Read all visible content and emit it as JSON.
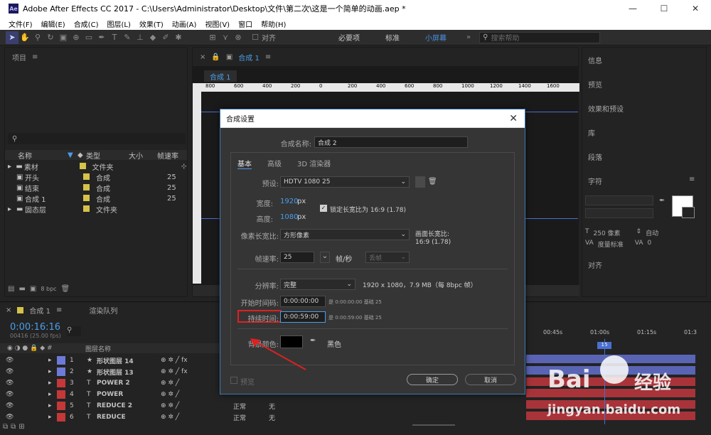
{
  "app": {
    "title": "Adobe After Effects CC 2017 - C:\\Users\\Administrator\\Desktop\\文件\\第二次\\这是一个简单的动画.aep *",
    "icon_label": "Ae"
  },
  "menu": [
    "文件(F)",
    "编辑(E)",
    "合成(C)",
    "图层(L)",
    "效果(T)",
    "动画(A)",
    "视图(V)",
    "窗口",
    "帮助(H)"
  ],
  "toolbar": {
    "align_label": "对齐",
    "workspaces": [
      "必要项",
      "标准",
      "小屏幕"
    ],
    "active_workspace": "小屏幕",
    "search_placeholder": "搜索帮助"
  },
  "project": {
    "title": "项目",
    "columns": [
      "名称",
      "类型",
      "大小",
      "帧速率"
    ],
    "items": [
      {
        "name": "素材",
        "type": "文件夹",
        "rate": "",
        "color": "#d4c24a"
      },
      {
        "name": "开头",
        "type": "合成",
        "rate": "25",
        "color": "#d4c24a"
      },
      {
        "name": "结束",
        "type": "合成",
        "rate": "25",
        "color": "#d4c24a"
      },
      {
        "name": "合成 1",
        "type": "合成",
        "rate": "25",
        "color": "#d4c24a"
      },
      {
        "name": "固态层",
        "type": "文件夹",
        "rate": "",
        "color": "#d4c24a"
      }
    ],
    "bpc": "8 bpc"
  },
  "comp_panel": {
    "tab": "合成 1",
    "label": "合成 1",
    "ruler": [
      "800",
      "600",
      "400",
      "200",
      "0",
      "200",
      "400",
      "600",
      "800",
      "1000",
      "1200",
      "1400",
      "1600"
    ]
  },
  "right_panel": {
    "items": [
      "信息",
      "预览",
      "效果和预设",
      "库",
      "段落",
      "字符",
      "对齐"
    ],
    "font_size": "250 像素",
    "auto": "自动",
    "metrics": "度量标准",
    "zero": "0"
  },
  "dialog": {
    "title": "合成设置",
    "name_label": "合成名称:",
    "name_value": "合成 2",
    "tabs": [
      "基本",
      "高级",
      "3D 渲染器"
    ],
    "preset_label": "预设:",
    "preset_value": "HDTV 1080 25",
    "width_label": "宽度:",
    "width_value": "1920",
    "height_label": "高度:",
    "height_value": "1080",
    "px": "px",
    "lock_label": "锁定长宽比为 16:9 (1.78)",
    "par_label": "像素长宽比:",
    "par_value": "方形像素",
    "frame_ar_label": "画面长宽比:",
    "frame_ar_value": "16:9 (1.78)",
    "fps_label": "帧速率:",
    "fps_value": "25",
    "fps_unit": "帧/秒",
    "fps_drop": "丢帧",
    "res_label": "分辨率:",
    "res_value": "完整",
    "res_info": "1920 x 1080，7.9 MB（每 8bpc 帧）",
    "start_label": "开始时间码:",
    "start_value": "0:00:00:00",
    "start_info": "是 0:00:00:00  基础 25",
    "dur_label": "持续时间:",
    "dur_value": "0:00:59:00",
    "dur_info": "是 0:00:59:00  基础 25",
    "bg_label": "背景颜色:",
    "bg_name": "黑色",
    "preview_label": "预览",
    "ok": "确定",
    "cancel": "取消",
    "close": "✕"
  },
  "timeline": {
    "tab": "合成 1",
    "render_queue": "渲染队列",
    "timecode": "0:00:16:16",
    "fps_note": "00416 (25.00 fps)",
    "col_layer": "图层名称",
    "ruler": [
      "00:45s",
      "01:00s",
      "01:15s",
      "01:3"
    ],
    "layers": [
      {
        "num": "1",
        "type": "★",
        "name": "形状图层 14",
        "color": "#6d7bd6"
      },
      {
        "num": "2",
        "type": "★",
        "name": "形状图层 13",
        "color": "#6d7bd6"
      },
      {
        "num": "3",
        "type": "T",
        "name": "POWER 2",
        "color": "#c4383a"
      },
      {
        "num": "4",
        "type": "T",
        "name": "POWER",
        "color": "#c4383a"
      },
      {
        "num": "5",
        "type": "T",
        "name": "REDUCE 2",
        "color": "#c4383a"
      },
      {
        "num": "6",
        "type": "T",
        "name": "REDUCE",
        "color": "#c4383a"
      }
    ],
    "mode": "正常",
    "none": "无"
  },
  "watermark": {
    "brand": "Bai",
    "brand2": "经验",
    "url": "jingyan.baidu.com"
  },
  "colors": {
    "accent": "#4a9ee8",
    "highlight_box": "#e02020",
    "arrow": "#e02020"
  }
}
